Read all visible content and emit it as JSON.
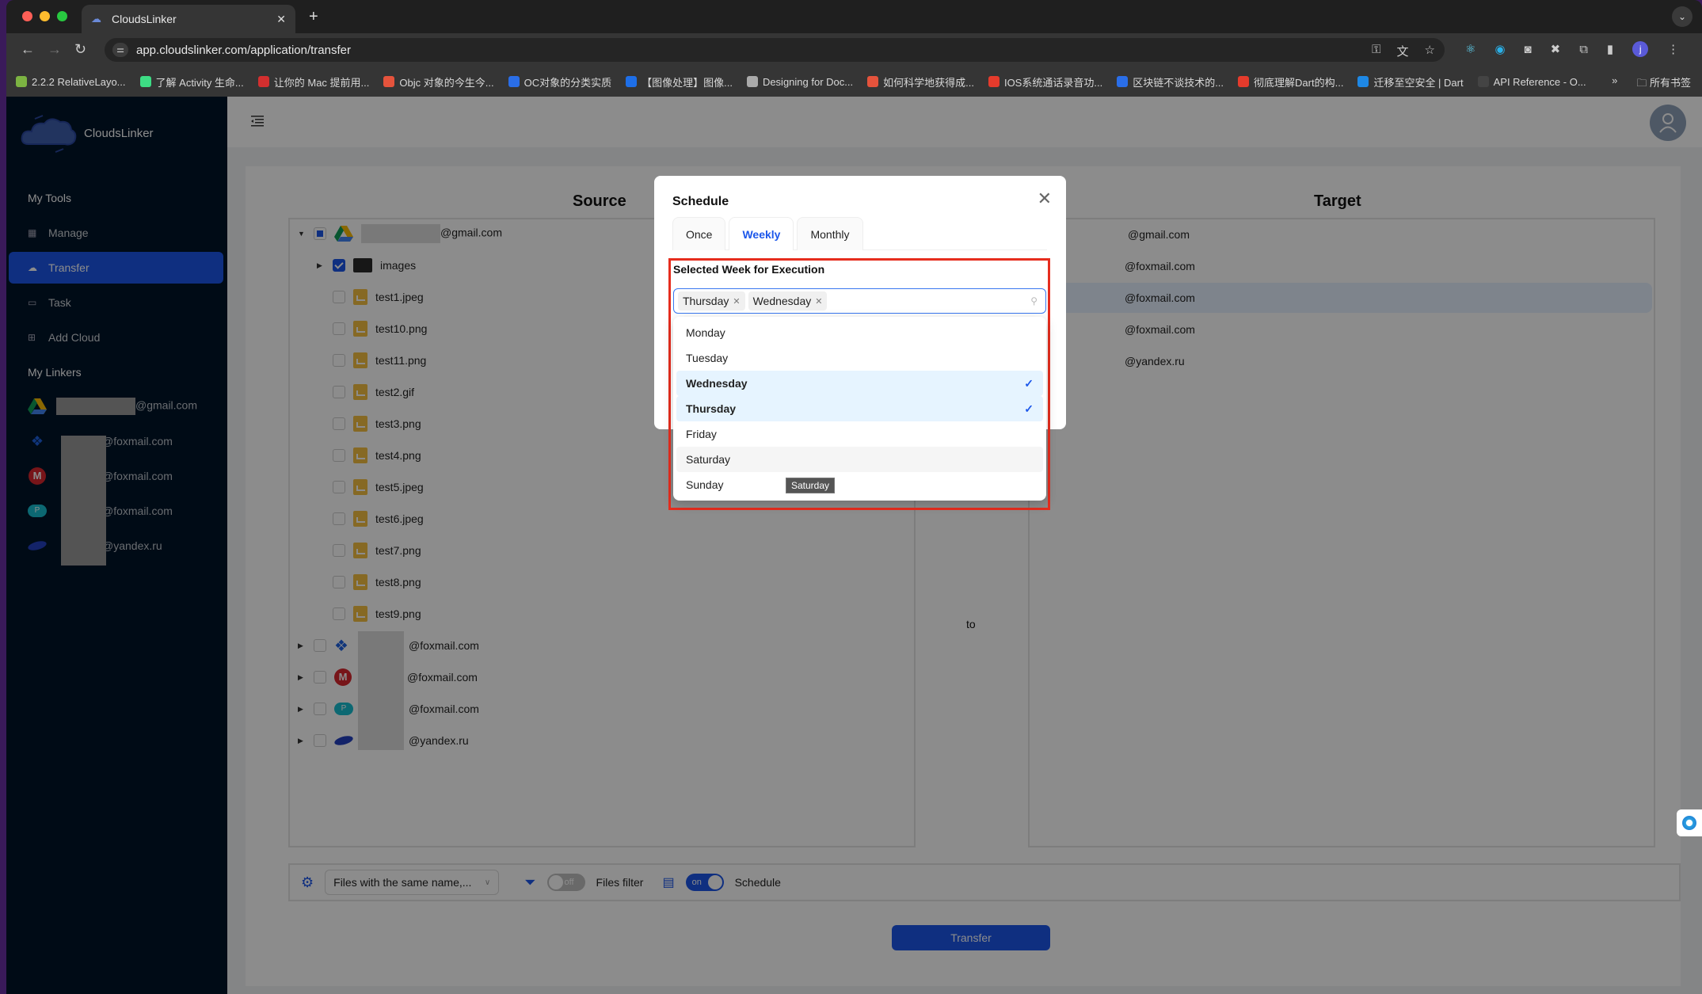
{
  "browser": {
    "tab_title": "CloudsLinker",
    "url": "app.cloudslinker.com/application/transfer",
    "profile_initial": "j",
    "bookmarks": [
      {
        "label": "2.2.2 RelativeLayo...",
        "color": "#7cb342"
      },
      {
        "label": "了解 Activity 生命...",
        "color": "#3ddc84"
      },
      {
        "label": "让你的 Mac 提前用...",
        "color": "#d32f2f"
      },
      {
        "label": "Objc 对象的今生今...",
        "color": "#e5533c"
      },
      {
        "label": "OC对象的分类实质",
        "color": "#2a6ee8"
      },
      {
        "label": "【图像处理】图像...",
        "color": "#1e6fe8"
      },
      {
        "label": "Designing for Doc...",
        "color": "#aaaaaa"
      },
      {
        "label": "如何科学地获得成...",
        "color": "#e5533c"
      },
      {
        "label": "IOS系统通话录音功...",
        "color": "#e53b2c"
      },
      {
        "label": "区块链不谈技术的...",
        "color": "#2a6ee8"
      },
      {
        "label": "彻底理解Dart的构...",
        "color": "#e53b2c"
      },
      {
        "label": "迁移至空安全 | Dart",
        "color": "#1e88e5"
      },
      {
        "label": "API Reference - O...",
        "color": "#444444"
      }
    ],
    "more_bookmarks": "»",
    "all_bookmarks": "所有书签"
  },
  "sidebar": {
    "brand": "CloudsLinker",
    "tools_heading": "My Tools",
    "items": [
      {
        "label": "Manage",
        "icon": "grid-icon",
        "active": false
      },
      {
        "label": "Transfer",
        "icon": "cloud-upload-icon",
        "active": true
      },
      {
        "label": "Task",
        "icon": "calendar-icon",
        "active": false
      },
      {
        "label": "Add Cloud",
        "icon": "add-grid-icon",
        "active": false
      }
    ],
    "linkers_heading": "My Linkers",
    "linkers": [
      {
        "suffix": "@gmail.com",
        "service": "google-drive"
      },
      {
        "suffix": "@foxmail.com",
        "service": "dropbox"
      },
      {
        "suffix": "@foxmail.com",
        "service": "mega"
      },
      {
        "suffix": "@foxmail.com",
        "service": "pcloud"
      },
      {
        "suffix": "@yandex.ru",
        "service": "yandex"
      }
    ]
  },
  "main": {
    "source_title": "Source",
    "target_title": "Target",
    "to_label": "to",
    "source_tree": {
      "root": {
        "suffix": "@gmail.com",
        "service": "google-drive",
        "expanded": true,
        "check": "partial"
      },
      "folder": {
        "name": "images",
        "check": "checked"
      },
      "files": [
        "test1.jpeg",
        "test10.png",
        "test11.png",
        "test2.gif",
        "test3.png",
        "test4.png",
        "test5.jpeg",
        "test6.jpeg",
        "test7.png",
        "test8.png",
        "test9.png"
      ],
      "other_accounts": [
        {
          "suffix": "@foxmail.com",
          "service": "dropbox"
        },
        {
          "suffix": "@foxmail.com",
          "service": "mega"
        },
        {
          "suffix": "@foxmail.com",
          "service": "pcloud"
        },
        {
          "suffix": "@yandex.ru",
          "service": "yandex"
        }
      ]
    },
    "target_list": [
      {
        "suffix": "@gmail.com",
        "selected": false
      },
      {
        "suffix": "@foxmail.com",
        "selected": false
      },
      {
        "suffix": "@foxmail.com",
        "selected": true
      },
      {
        "suffix": "@foxmail.com",
        "selected": false
      },
      {
        "suffix": "@yandex.ru",
        "selected": false
      }
    ],
    "options": {
      "conflict_select": "Files with the same name,...",
      "files_filter_label": "Files filter",
      "files_filter_state": "off",
      "schedule_label": "Schedule",
      "schedule_state": "on"
    },
    "transfer_button": "Transfer"
  },
  "modal": {
    "title": "Schedule",
    "tabs": [
      {
        "label": "Once",
        "active": false
      },
      {
        "label": "Weekly",
        "active": true
      },
      {
        "label": "Monthly",
        "active": false
      }
    ],
    "field_label": "Selected Week for Execution",
    "selected_tags": [
      "Thursday",
      "Wednesday"
    ],
    "options": [
      {
        "label": "Monday",
        "selected": false,
        "hover": false
      },
      {
        "label": "Tuesday",
        "selected": false,
        "hover": false
      },
      {
        "label": "Wednesday",
        "selected": true,
        "hover": false
      },
      {
        "label": "Thursday",
        "selected": true,
        "hover": false
      },
      {
        "label": "Friday",
        "selected": false,
        "hover": false
      },
      {
        "label": "Saturday",
        "selected": false,
        "hover": true
      },
      {
        "label": "Sunday",
        "selected": false,
        "hover": false
      }
    ],
    "tooltip": "Saturday"
  },
  "colors": {
    "accent": "#1c57ea",
    "sidebar_bg": "#001529",
    "highlight_box": "#e62d1e",
    "selected_option_bg": "#e6f4ff"
  }
}
